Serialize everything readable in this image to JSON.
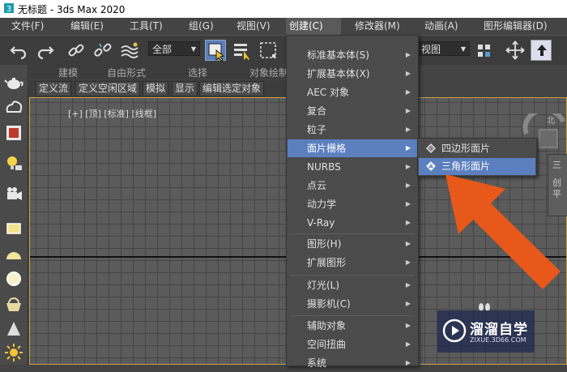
{
  "title_bar": {
    "title": "无标题 - 3ds Max 2020"
  },
  "menu_bar": [
    {
      "label": "文件(F)"
    },
    {
      "label": "编辑(E)"
    },
    {
      "label": "工具(T)"
    },
    {
      "label": "组(G)"
    },
    {
      "label": "视图(V)"
    },
    {
      "label": "创建(C)"
    },
    {
      "label": "修改器(M)"
    },
    {
      "label": "动画(A)"
    },
    {
      "label": "图形编辑器(D)"
    }
  ],
  "toolbar": {
    "selection_set": "全部",
    "view_dropdown": "视图"
  },
  "ribbon": {
    "sections": [
      "建模",
      "自由形式",
      "选择",
      "对象绘制"
    ],
    "tabs": [
      "定义流",
      "定义空闲区域",
      "模拟",
      "显示",
      "编辑选定对象"
    ]
  },
  "viewport": {
    "label": "[+] [顶] [标准] [线框]"
  },
  "create_menu": {
    "items": [
      {
        "label": "标准基本体(S)",
        "submenu": true
      },
      {
        "label": "扩展基本体(X)",
        "submenu": true
      },
      {
        "label": "AEC 对象",
        "submenu": true
      },
      {
        "label": "复合",
        "submenu": true
      },
      {
        "label": "粒子",
        "submenu": true
      },
      {
        "label": "面片栅格",
        "submenu": true,
        "highlighted": true
      },
      {
        "label": "NURBS",
        "submenu": true
      },
      {
        "label": "点云",
        "submenu": true
      },
      {
        "label": "动力学",
        "submenu": true
      },
      {
        "label": "V-Ray",
        "submenu": true
      },
      {
        "label": "图形(H)",
        "submenu": true
      },
      {
        "label": "扩展图形",
        "submenu": true
      },
      {
        "label": "灯光(L)",
        "submenu": true
      },
      {
        "label": "摄影机(C)",
        "submenu": true
      },
      {
        "label": "辅助对象",
        "submenu": true
      },
      {
        "label": "空间扭曲",
        "submenu": true
      },
      {
        "label": "系统",
        "submenu": true
      }
    ]
  },
  "patch_submenu": {
    "items": [
      {
        "label": "四边形面片",
        "highlighted": false
      },
      {
        "label": "三角形面片",
        "highlighted": true
      }
    ]
  },
  "viewcube": {
    "label": "北"
  },
  "right_panel": {
    "lines": [
      "三",
      "创",
      "平"
    ]
  },
  "watermark": {
    "name": "溜溜自学",
    "url": "ZIXUE.3D66.COM"
  },
  "colors": {
    "highlight": "#5b7fbf",
    "arrow": "#e8581a",
    "viewport_border": "#c8a14a"
  }
}
